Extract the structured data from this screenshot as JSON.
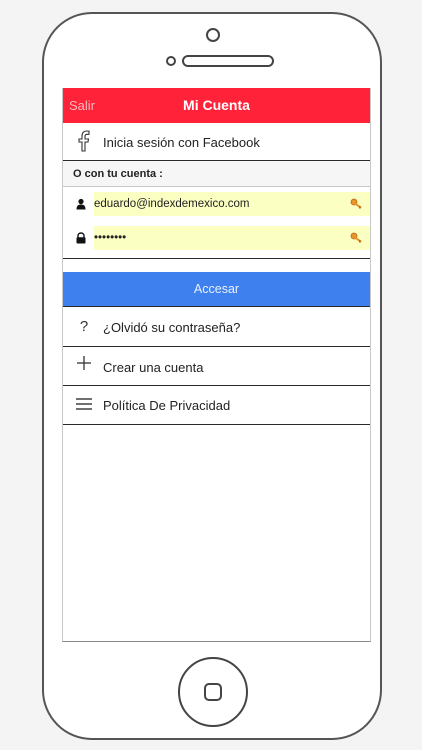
{
  "nav": {
    "back_label": "Salir",
    "title": "Mi Cuenta"
  },
  "facebook": {
    "icon": "facebook-icon",
    "label": "Inicia sesión con Facebook"
  },
  "account_section": {
    "header": "O con tu cuenta :"
  },
  "email_field": {
    "icon": "user-icon",
    "value": "eduardo@indexdemexico.com"
  },
  "password_field": {
    "icon": "lock-icon",
    "value": "••••••••"
  },
  "login_button": {
    "label": "Accesar"
  },
  "menu": {
    "forgot": {
      "icon": "question-icon",
      "label": "¿Olvidó su contraseña?"
    },
    "create": {
      "icon": "plus-icon",
      "label": "Crear una cuenta"
    },
    "privacy": {
      "icon": "menu-icon",
      "label": "Política De Privacidad"
    }
  },
  "colors": {
    "navbar": "#ff2238",
    "button": "#3d80ee",
    "autofill": "#fcffc2"
  }
}
